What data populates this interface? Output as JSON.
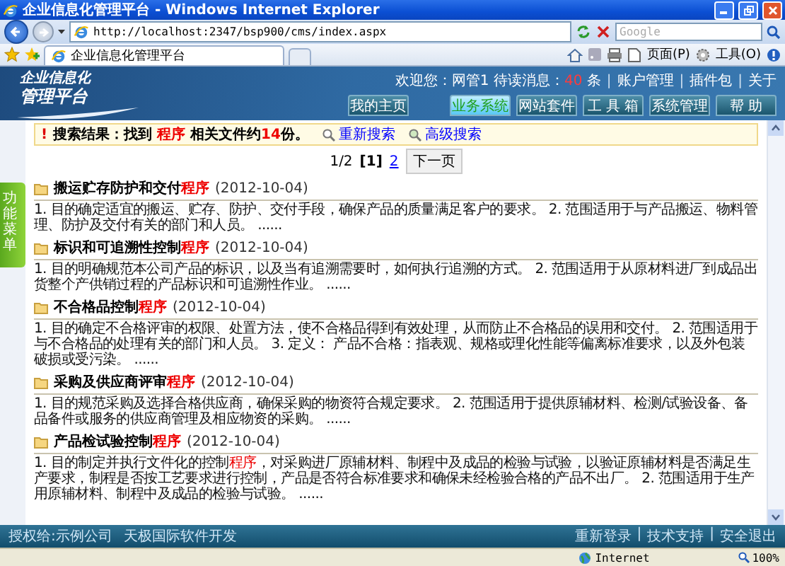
{
  "window": {
    "title": "企业信息化管理平台 - Windows Internet Explorer"
  },
  "address_bar": {
    "url": "http://localhost:2347/bsp900/cms/index.aspx"
  },
  "search_box": {
    "placeholder": "Google"
  },
  "browser_tab": {
    "title": "企业信息化管理平台"
  },
  "toolbar": {
    "page_menu": "页面(P)",
    "tools_menu": "工具(O)"
  },
  "header": {
    "logo_line_1": "企业信息化",
    "logo_line_2": "管理平台",
    "welcome": "欢迎您：网管1 待读消息：",
    "unread_count": "40",
    "unread_unit": "条",
    "separator": "|",
    "links": [
      "账户管理",
      "插件包",
      "关于"
    ],
    "nav": [
      {
        "label": "我的主页",
        "selected": false
      },
      {
        "label": "业务系统",
        "selected": true
      },
      {
        "label": "网站套件",
        "selected": false
      },
      {
        "label": "工 具 箱",
        "selected": false
      },
      {
        "label": "系统管理",
        "selected": false
      },
      {
        "label": "帮 助",
        "selected": false
      }
    ]
  },
  "side_tab": {
    "label": "功能菜单"
  },
  "search_result": {
    "alert": "!",
    "label": "搜索结果：找到",
    "keyword": "程序",
    "middle": "相关文件约",
    "count": "14",
    "suffix": "份。",
    "actions": [
      "重新搜索",
      "高级搜索"
    ]
  },
  "pager": {
    "position": "1/2",
    "pages": [
      {
        "label": "[1]",
        "selected": true
      },
      {
        "label": "2",
        "selected": false
      }
    ],
    "next": "下一页"
  },
  "results": [
    {
      "title": [
        {
          "text": "搬运贮存防护和交付",
          "highlight": false
        },
        {
          "text": "程序",
          "highlight": true
        }
      ],
      "date": "(2012-10-04)",
      "summary": [
        {
          "text": "1. 目的确定适宜的搬运、贮存、防护、交付手段，确保产品的质量满足客户的要求。 2. 范围适用于与产品搬运、物料管理、防护及交付有关的部门和人员。 ......",
          "highlight": false
        }
      ]
    },
    {
      "title": [
        {
          "text": "标识和可追溯性控制",
          "highlight": false
        },
        {
          "text": "程序",
          "highlight": true
        }
      ],
      "date": "(2012-10-04)",
      "summary": [
        {
          "text": "1. 目的明确规范本公司产品的标识，以及当有追溯需要时，如何执行追溯的方式。 2. 范围适用于从原材料进厂到成品出货整个产供销过程的产品标识和可追溯性作业。 ......",
          "highlight": false
        }
      ]
    },
    {
      "title": [
        {
          "text": "不合格品控制",
          "highlight": false
        },
        {
          "text": "程序",
          "highlight": true
        }
      ],
      "date": "(2012-10-04)",
      "summary": [
        {
          "text": "1. 目的确定不合格评审的权限、处置方法，使不合格品得到有效处理，从而防止不合格品的误用和交付。 2. 范围适用于与不合格品的处理有关的部门和人员。 3. 定义： 产品不合格：指表观、规格或理化性能等偏离标准要求，以及外包装破损或受污染。 ......",
          "highlight": false
        }
      ]
    },
    {
      "title": [
        {
          "text": "采购及供应商评审",
          "highlight": false
        },
        {
          "text": "程序",
          "highlight": true
        }
      ],
      "date": "(2012-10-04)",
      "summary": [
        {
          "text": "1. 目的规范采购及选择合格供应商，确保采购的物资符合规定要求。 2. 范围适用于提供原辅材料、检测/试验设备、备品备件或服务的供应商管理及相应物资的采购。 ......",
          "highlight": false
        }
      ]
    },
    {
      "title": [
        {
          "text": "产品检试验控制",
          "highlight": false
        },
        {
          "text": "程序",
          "highlight": true
        }
      ],
      "date": "(2012-10-04)",
      "summary": [
        {
          "text": "1. 目的制定并执行文件化的控制",
          "highlight": false
        },
        {
          "text": "程序",
          "highlight": true
        },
        {
          "text": "，对采购进厂原辅材料、制程中及成品的检验与试验，以验证原辅材料是否满足生产要求，制程是否按工艺要求进行控制，产品是否符合标准要求和确保未经检验合格的产品不出厂。 2. 范围适用于生产用原辅材料、制程中及成品的检验与试验。 ......",
          "highlight": false
        }
      ]
    }
  ],
  "footer": {
    "left": [
      "授权给:示例公司",
      "天极国际软件开发"
    ],
    "separator": "|",
    "links": [
      "重新登录",
      "技术支持",
      "安全退出"
    ]
  },
  "status_bar": {
    "zone": "Internet",
    "zoom": "100%"
  }
}
